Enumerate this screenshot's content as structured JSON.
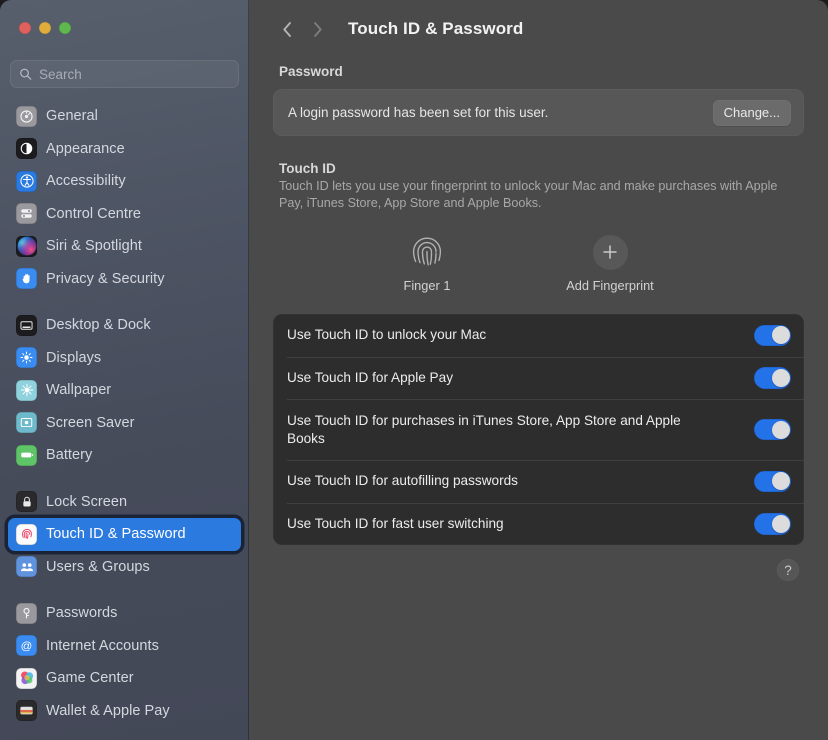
{
  "window": {
    "traffic_lights": [
      {
        "name": "close",
        "color": "#e0605d"
      },
      {
        "name": "minimize",
        "color": "#e0ac3c"
      },
      {
        "name": "maximize",
        "color": "#5fb84e"
      }
    ]
  },
  "search": {
    "placeholder": "Search",
    "value": ""
  },
  "sidebar": {
    "groups": [
      {
        "items": [
          {
            "label": "General",
            "icon": "gear-icon",
            "selected": false
          },
          {
            "label": "Appearance",
            "icon": "appearance-icon",
            "selected": false
          },
          {
            "label": "Accessibility",
            "icon": "accessibility-icon",
            "selected": false
          },
          {
            "label": "Control Centre",
            "icon": "control-centre-icon",
            "selected": false
          },
          {
            "label": "Siri & Spotlight",
            "icon": "siri-icon",
            "selected": false
          },
          {
            "label": "Privacy & Security",
            "icon": "privacy-hand-icon",
            "selected": false
          }
        ]
      },
      {
        "items": [
          {
            "label": "Desktop & Dock",
            "icon": "desktop-dock-icon",
            "selected": false
          },
          {
            "label": "Displays",
            "icon": "displays-icon",
            "selected": false
          },
          {
            "label": "Wallpaper",
            "icon": "wallpaper-icon",
            "selected": false
          },
          {
            "label": "Screen Saver",
            "icon": "screen-saver-icon",
            "selected": false
          },
          {
            "label": "Battery",
            "icon": "battery-icon",
            "selected": false
          }
        ]
      },
      {
        "items": [
          {
            "label": "Lock Screen",
            "icon": "lock-icon",
            "selected": false
          },
          {
            "label": "Touch ID & Password",
            "icon": "touch-id-icon",
            "selected": true
          },
          {
            "label": "Users & Groups",
            "icon": "users-groups-icon",
            "selected": false
          }
        ]
      },
      {
        "items": [
          {
            "label": "Passwords",
            "icon": "key-icon",
            "selected": false
          },
          {
            "label": "Internet Accounts",
            "icon": "at-sign-icon",
            "selected": false
          },
          {
            "label": "Game Center",
            "icon": "game-center-icon",
            "selected": false
          },
          {
            "label": "Wallet & Apple Pay",
            "icon": "wallet-icon",
            "selected": false
          }
        ]
      }
    ]
  },
  "toolbar": {
    "back_icon": "chevron-left-icon",
    "forward_icon": "chevron-right-icon",
    "title": "Touch ID & Password"
  },
  "password_section": {
    "label": "Password",
    "status": "A login password has been set for this user.",
    "change_button": "Change..."
  },
  "touch_id_section": {
    "heading": "Touch ID",
    "description": "Touch ID lets you use your fingerprint to unlock your Mac and make purchases with Apple Pay, iTunes Store, App Store and Apple Books.",
    "fingerprints": [
      {
        "label": "Finger 1",
        "icon": "fingerprint-icon"
      },
      {
        "label": "Add Fingerprint",
        "icon": "plus-icon"
      }
    ]
  },
  "toggles": [
    {
      "label": "Use Touch ID to unlock your Mac",
      "on": true,
      "tall": false
    },
    {
      "label": "Use Touch ID for Apple Pay",
      "on": true,
      "tall": false
    },
    {
      "label": "Use Touch ID for purchases in iTunes Store, App Store and Apple Books",
      "on": true,
      "tall": true
    },
    {
      "label": "Use Touch ID for autofilling passwords",
      "on": true,
      "tall": false
    },
    {
      "label": "Use Touch ID for fast user switching",
      "on": true,
      "tall": false
    }
  ],
  "help": {
    "label": "?"
  },
  "colors": {
    "accent_blue": "#2b7ae0",
    "toggle_on": "#2472e8",
    "main_bg": "#4a4a4a",
    "card_bg": "#2d2d2d",
    "sidebar_bg": "#4e5564"
  }
}
